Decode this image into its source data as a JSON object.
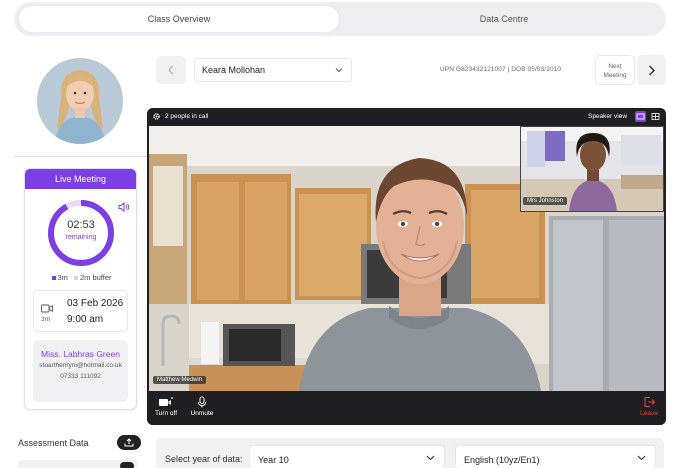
{
  "tabs": [
    {
      "label": "Class Overview",
      "active": true
    },
    {
      "label": "Data Centre",
      "active": false
    }
  ],
  "student": {
    "name": "Keara Mollohan",
    "upn_dob": "UPN G823432121007 | DOB 05/03/2010"
  },
  "nav": {
    "next_label": "Next Meeting"
  },
  "meeting_card": {
    "header": "Live Meeting",
    "time_remaining": "02:53",
    "remaining_label": "remaining",
    "legend": [
      "3m",
      "2m buffer"
    ],
    "progress_fraction": 0.92,
    "date": "03 Feb 2026",
    "time": "9:00 am",
    "duration": "3m",
    "teacher_name": "Miss. Labhras Green",
    "teacher_email": "stuarthenryni@hotmail.co.uk",
    "teacher_phone": "07333 111092"
  },
  "call": {
    "people_label": "2 people in call",
    "view_label": "Speaker view",
    "main_participant": "Matthew Medwin",
    "pip_participant": "Mrs Johnston",
    "controls": {
      "camera": "Turn off",
      "mic": "Unmute",
      "leave": "Leave"
    }
  },
  "assessment": {
    "label": "Assessment Data"
  },
  "data_select": {
    "label": "Select year of data:",
    "year": "Year 10",
    "subject": "English  (10yz/En1)"
  },
  "colors": {
    "accent": "#7b3fe4",
    "leave": "#e0453a"
  }
}
